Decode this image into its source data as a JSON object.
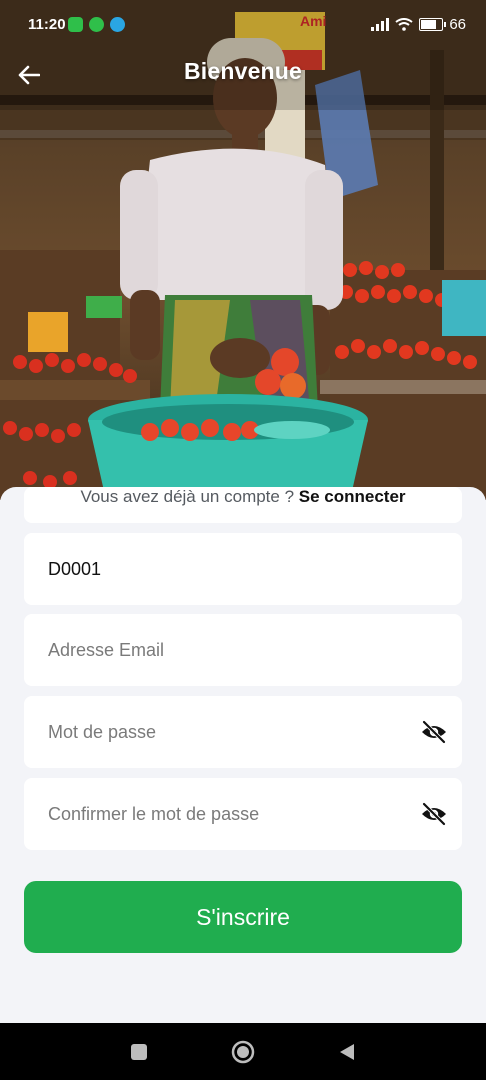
{
  "status_bar": {
    "time": "11:20",
    "battery_percent": "66",
    "battery_level": 0.66
  },
  "header": {
    "title": "Bienvenue",
    "back_icon": "arrow-left-icon"
  },
  "hero": {
    "image": "market vendor with tomatoes",
    "sign_text": "Ami"
  },
  "form": {
    "code_value": "D0001",
    "code_placeholder": "",
    "email_placeholder": "Adresse Email",
    "password_placeholder": "Mot de passe",
    "confirm_placeholder": "Confirmer le mot de passe",
    "visibility_icon": "eye-off-icon",
    "submit_label": "S'inscrire"
  },
  "footer": {
    "prompt": "Vous avez déjà un compte ? ",
    "login_link": "Se connecter"
  },
  "colors": {
    "primary": "#20ad4f",
    "sheet_background": "#f3f4f8",
    "field_background": "#ffffff"
  }
}
